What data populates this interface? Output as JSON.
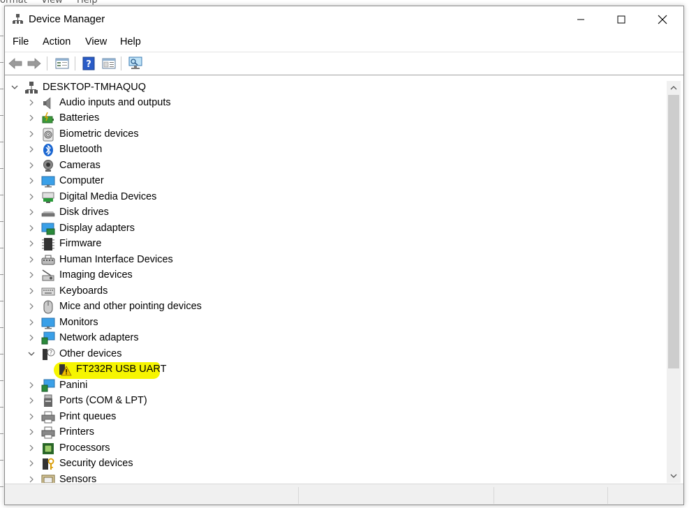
{
  "window": {
    "title": "Device Manager",
    "controls": {
      "minimize": "minimize",
      "maximize": "maximize",
      "close": "close"
    }
  },
  "background": {
    "menu": [
      "ormat",
      "View",
      "Help"
    ]
  },
  "menubar": [
    "File",
    "Action",
    "View",
    "Help"
  ],
  "toolbar": {
    "buttons": [
      "back-arrow-icon",
      "forward-arrow-icon",
      "properties-icon",
      "help-icon",
      "show-hidden-icon",
      "scan-hardware-icon"
    ]
  },
  "tree": {
    "root": "DESKTOP-TMHAQUQ",
    "items": [
      {
        "label": "Audio inputs and outputs",
        "icon": "speaker-icon",
        "expanded": false
      },
      {
        "label": "Batteries",
        "icon": "battery-icon",
        "expanded": false
      },
      {
        "label": "Biometric devices",
        "icon": "fingerprint-icon",
        "expanded": false
      },
      {
        "label": "Bluetooth",
        "icon": "bluetooth-icon",
        "expanded": false
      },
      {
        "label": "Cameras",
        "icon": "camera-icon",
        "expanded": false
      },
      {
        "label": "Computer",
        "icon": "monitor-icon",
        "expanded": false
      },
      {
        "label": "Digital Media Devices",
        "icon": "media-device-icon",
        "expanded": false
      },
      {
        "label": "Disk drives",
        "icon": "disk-drive-icon",
        "expanded": false
      },
      {
        "label": "Display adapters",
        "icon": "display-adapter-icon",
        "expanded": false
      },
      {
        "label": "Firmware",
        "icon": "chip-icon",
        "expanded": false
      },
      {
        "label": "Human Interface Devices",
        "icon": "hid-icon",
        "expanded": false
      },
      {
        "label": "Imaging devices",
        "icon": "scanner-icon",
        "expanded": false
      },
      {
        "label": "Keyboards",
        "icon": "keyboard-icon",
        "expanded": false
      },
      {
        "label": "Mice and other pointing devices",
        "icon": "mouse-icon",
        "expanded": false
      },
      {
        "label": "Monitors",
        "icon": "monitor-icon",
        "expanded": false
      },
      {
        "label": "Network adapters",
        "icon": "network-icon",
        "expanded": false
      },
      {
        "label": "Other devices",
        "icon": "unknown-device-icon",
        "expanded": true,
        "children": [
          {
            "label": "FT232R USB UART",
            "icon": "warning-device-icon",
            "highlighted": true
          }
        ]
      },
      {
        "label": "Panini",
        "icon": "network-icon",
        "expanded": false
      },
      {
        "label": "Ports (COM & LPT)",
        "icon": "port-icon",
        "expanded": false
      },
      {
        "label": "Print queues",
        "icon": "printer-icon",
        "expanded": false
      },
      {
        "label": "Printers",
        "icon": "printer-icon",
        "expanded": false
      },
      {
        "label": "Processors",
        "icon": "processor-icon",
        "expanded": false
      },
      {
        "label": "Security devices",
        "icon": "security-key-icon",
        "expanded": false
      },
      {
        "label": "Sensors",
        "icon": "sensor-icon",
        "expanded": false
      }
    ]
  },
  "colors": {
    "highlight": "#f6f500",
    "scrollbar_thumb": "#cdcdcd",
    "statusbar": "#f0f0f0"
  }
}
